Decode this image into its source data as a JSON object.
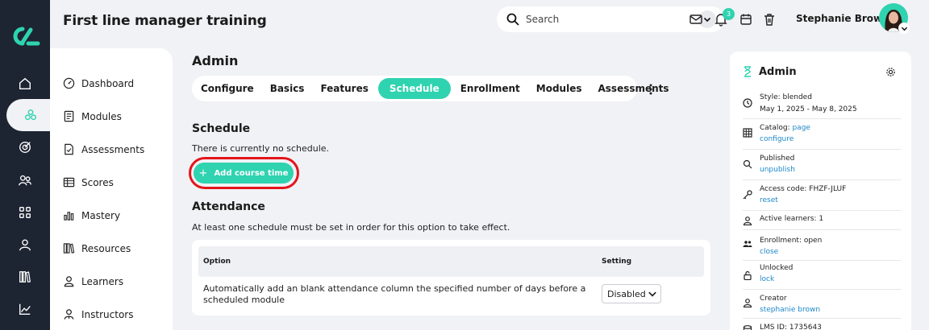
{
  "header": {
    "course_title": "First line manager training",
    "search": {
      "placeholder": "Search"
    },
    "notification_count": "3",
    "user_name": "Stephanie Brown"
  },
  "sidebar": {
    "items": [
      {
        "label": "Dashboard",
        "icon": "dashboard-icon"
      },
      {
        "label": "Modules",
        "icon": "book-icon"
      },
      {
        "label": "Assessments",
        "icon": "assessment-icon"
      },
      {
        "label": "Scores",
        "icon": "table-icon"
      },
      {
        "label": "Mastery",
        "icon": "bar-chart-icon"
      },
      {
        "label": "Resources",
        "icon": "library-icon"
      },
      {
        "label": "Learners",
        "icon": "person-icon"
      },
      {
        "label": "Instructors",
        "icon": "instructor-icon"
      }
    ]
  },
  "main": {
    "page_title": "Admin",
    "tabs": [
      {
        "label": "Configure"
      },
      {
        "label": "Basics"
      },
      {
        "label": "Features"
      },
      {
        "label": "Schedule",
        "active": true
      },
      {
        "label": "Enrollment"
      },
      {
        "label": "Modules"
      },
      {
        "label": "Assessments"
      }
    ],
    "schedule": {
      "heading": "Schedule",
      "empty_text": "There is currently no schedule.",
      "add_button": "Add course time"
    },
    "attendance": {
      "heading": "Attendance",
      "note": "At least one schedule must be set in order for this option to take effect.",
      "col_option": "Option",
      "col_setting": "Setting",
      "row_text": "Automatically add an blank attendance column the specified number of days before a scheduled module",
      "row_value": "Disabled"
    }
  },
  "panel": {
    "title": "Admin",
    "items": [
      {
        "label": "Style: blended",
        "value": "May 1, 2025 - May 8, 2025",
        "icon": "clock-icon"
      },
      {
        "label": "Catalog: ",
        "label_link": "page",
        "value": "configure",
        "icon": "grid-icon"
      },
      {
        "label": "Published",
        "value": "unpublish",
        "icon": "search-icon"
      },
      {
        "label": "Access code: FHZF-JLUF",
        "value": "reset",
        "icon": "key-icon"
      },
      {
        "label": "Active learners: 1",
        "value": "",
        "icon": "person-icon"
      },
      {
        "label": "Enrollment: open",
        "value": "close",
        "icon": "group-icon"
      },
      {
        "label": "Unlocked",
        "value": "lock",
        "icon": "lock-icon"
      },
      {
        "label": "Creator",
        "value": "stephanie brown",
        "icon": "person-icon"
      },
      {
        "label": "LMS ID: 1735643",
        "value": "",
        "icon": "database-icon"
      }
    ]
  },
  "colors": {
    "accent": "#2fd3b0",
    "rail": "#1d2432",
    "link": "#1e88c9",
    "highlight": "#e5141b"
  }
}
